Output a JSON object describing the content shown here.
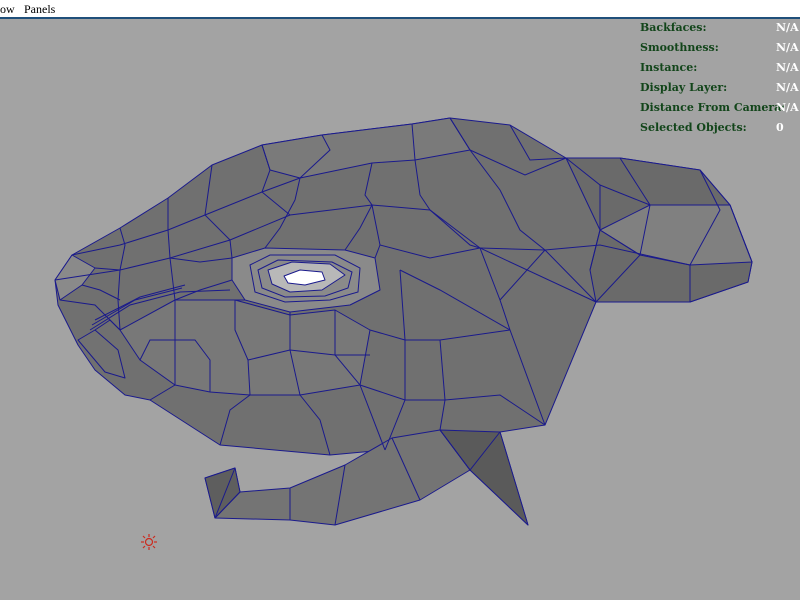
{
  "menubar": {
    "items": [
      {
        "label": "ow"
      },
      {
        "label": "Panels"
      }
    ]
  },
  "hud": {
    "rows": [
      {
        "label": "Backfaces:",
        "value": "N/A"
      },
      {
        "label": "Smoothness:",
        "value": "N/A"
      },
      {
        "label": "Instance:",
        "value": "N/A"
      },
      {
        "label": "Display Layer:",
        "value": "N/A"
      },
      {
        "label": "Distance From Camera:",
        "value": "N/A"
      },
      {
        "label": "Selected Objects:",
        "value": "0"
      }
    ]
  },
  "colors": {
    "viewport_bg": "#a3a3a3",
    "mesh_fill": "#6e6e6e",
    "mesh_wire": "#1a1a8c",
    "hud_label": "#12451a",
    "hud_value": "#ffffff",
    "light_icon": "#cc2b1f"
  },
  "icons": {
    "light": "point-light-icon"
  }
}
